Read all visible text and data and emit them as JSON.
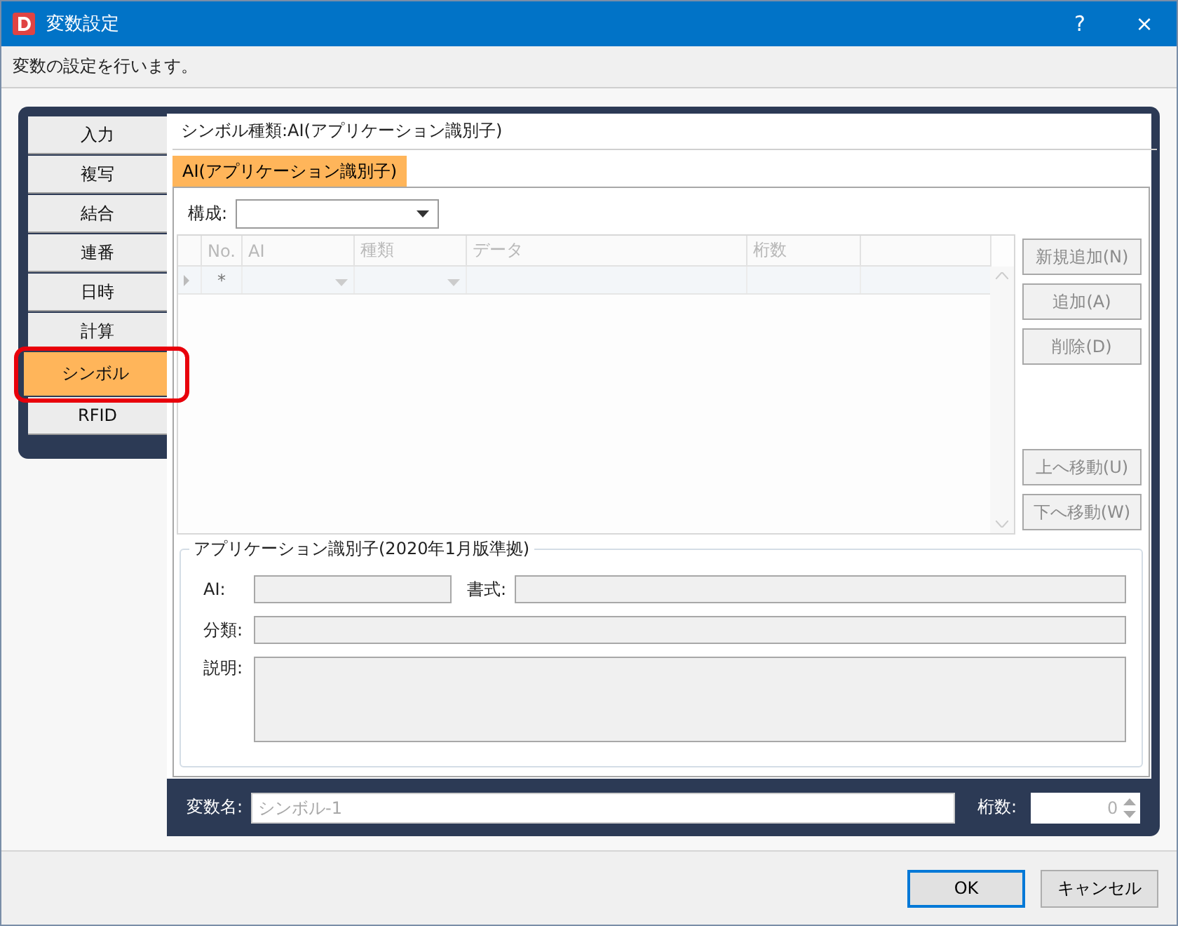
{
  "window": {
    "title": "変数設定",
    "help": "?",
    "close": "×"
  },
  "description": "変数の設定を行います。",
  "side_tabs": [
    {
      "label": "入力",
      "selected": false,
      "highlighted": false
    },
    {
      "label": "複写",
      "selected": false,
      "highlighted": false
    },
    {
      "label": "結合",
      "selected": false,
      "highlighted": false
    },
    {
      "label": "連番",
      "selected": false,
      "highlighted": false
    },
    {
      "label": "日時",
      "selected": false,
      "highlighted": false
    },
    {
      "label": "計算",
      "selected": false,
      "highlighted": false
    },
    {
      "label": "シンボル",
      "selected": true,
      "highlighted": true
    },
    {
      "label": "RFID",
      "selected": false,
      "highlighted": false
    }
  ],
  "symbol_type": "シンボル種類:AI(アプリケーション識別子)",
  "inner_tabs": [
    {
      "label": "AI(アプリケーション識別子)",
      "selected": true
    }
  ],
  "composition": {
    "label": "構成:"
  },
  "grid": {
    "columns": [
      "No.",
      "AI",
      "種類",
      "データ",
      "桁数",
      ""
    ],
    "new_row": {
      "marker": "*"
    }
  },
  "grid_buttons_top": [
    {
      "label": "新規追加(N)",
      "disabled": true
    },
    {
      "label": "追加(A)",
      "disabled": true
    },
    {
      "label": "削除(D)",
      "disabled": true
    }
  ],
  "grid_buttons_bottom": [
    {
      "label": "上へ移動(U)",
      "disabled": true
    },
    {
      "label": "下へ移動(W)",
      "disabled": true
    }
  ],
  "ai_group": {
    "title": "アプリケーション識別子(2020年1月版準拠)",
    "fields": [
      {
        "label": "AI:",
        "kind": "short"
      },
      {
        "label": "書式:",
        "kind": "wide"
      },
      {
        "label": "分類:",
        "kind": "full"
      },
      {
        "label": "説明:",
        "kind": "multiline"
      }
    ]
  },
  "variable_name": {
    "label": "変数名:",
    "placeholder": "シンボル-1"
  },
  "digits": {
    "label": "桁数:",
    "value": "0"
  },
  "buttons": [
    {
      "label": "OK",
      "default": true
    },
    {
      "label": "キャンセル",
      "default": false
    }
  ]
}
